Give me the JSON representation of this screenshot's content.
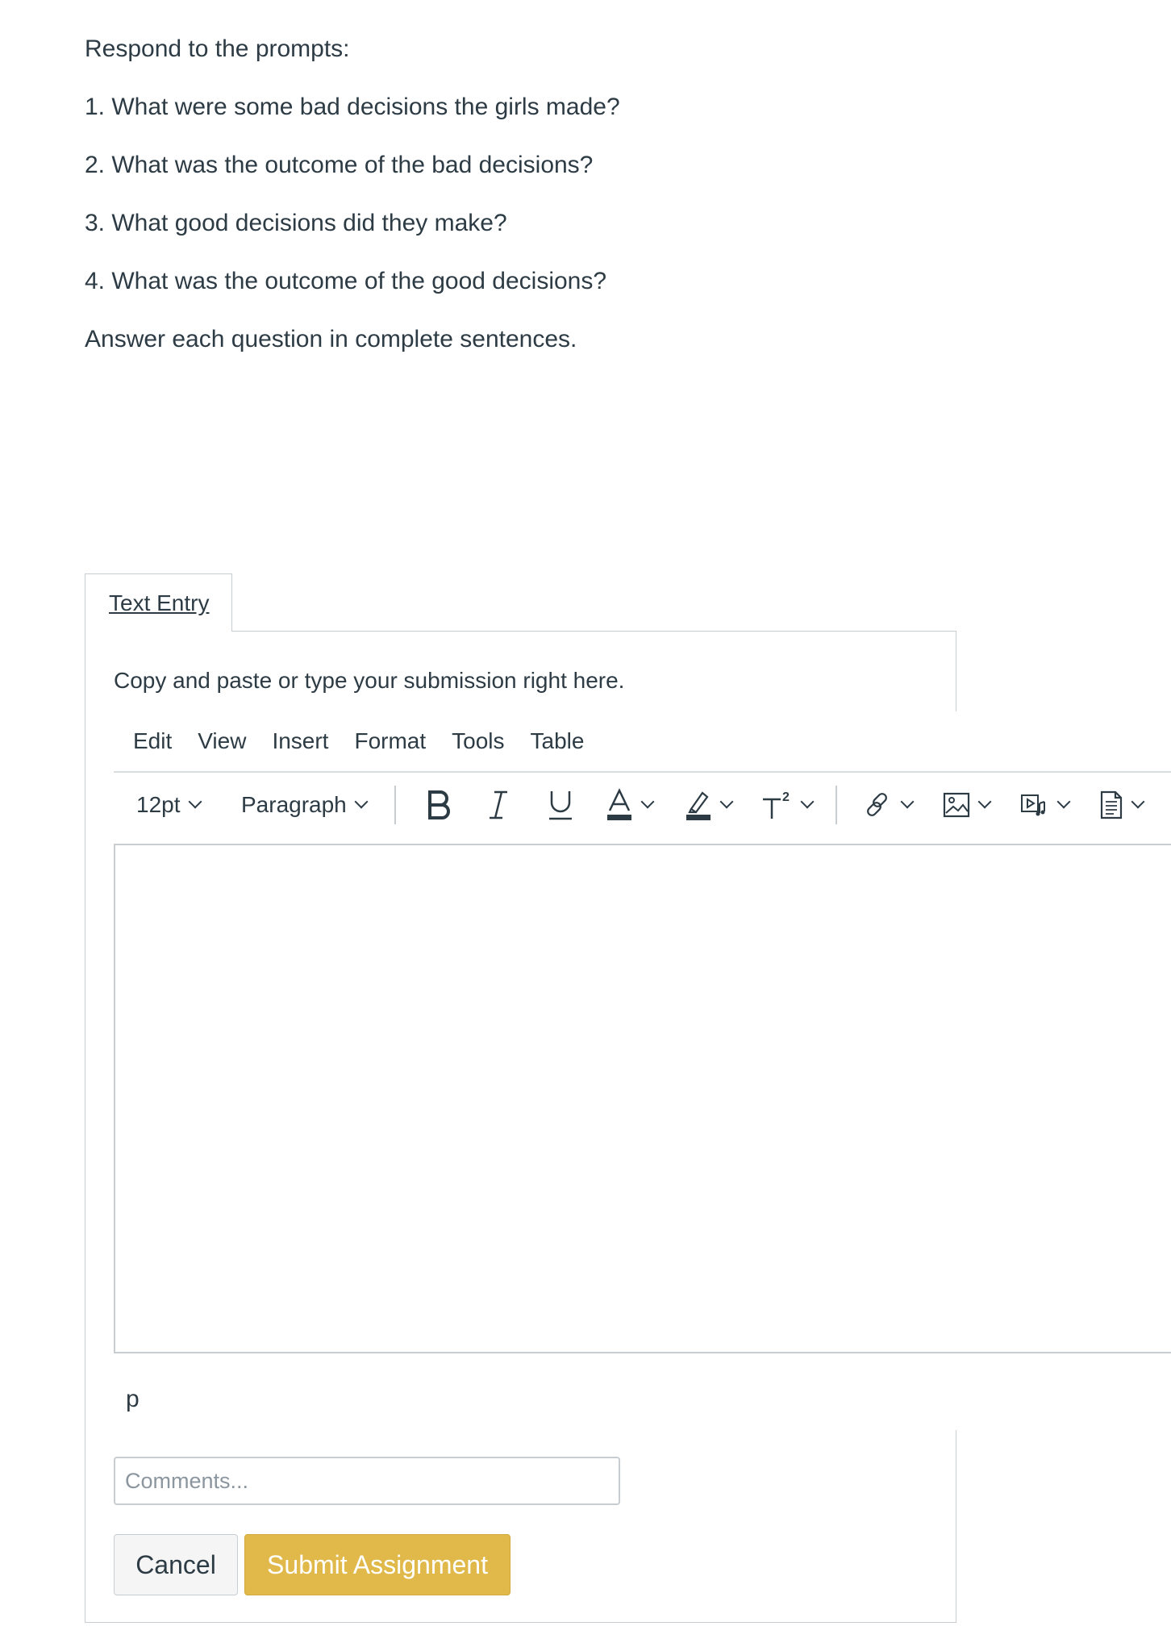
{
  "prompts": {
    "intro": "Respond to the prompts:",
    "q1": "1. What were some bad decisions the girls made?",
    "q2": "2. What was the outcome of the bad decisions?",
    "q3": "3. What good decisions did they make?",
    "q4": "4. What was the outcome of the good decisions?",
    "closing": "Answer each question in complete sentences."
  },
  "submission": {
    "tab_label": "Text Entry",
    "instructions": "Copy and paste or type your submission right here."
  },
  "editor": {
    "menu": [
      "Edit",
      "View",
      "Insert",
      "Format",
      "Tools",
      "Table"
    ],
    "font_size": "12pt",
    "block_format": "Paragraph",
    "toolbar_icons": [
      "bold-icon",
      "italic-icon",
      "underline-icon",
      "text-color-icon",
      "highlight-color-icon",
      "superscript-icon",
      "link-icon",
      "image-icon",
      "media-icon",
      "document-icon"
    ],
    "path_label": "p"
  },
  "comments": {
    "placeholder": "Comments..."
  },
  "buttons": {
    "cancel": "Cancel",
    "submit": "Submit Assignment"
  },
  "colors": {
    "submit_bg": "#e0b94a",
    "text": "#2d3b45",
    "border": "#c7cdd1",
    "text_color_bar": "#2d3b45"
  }
}
